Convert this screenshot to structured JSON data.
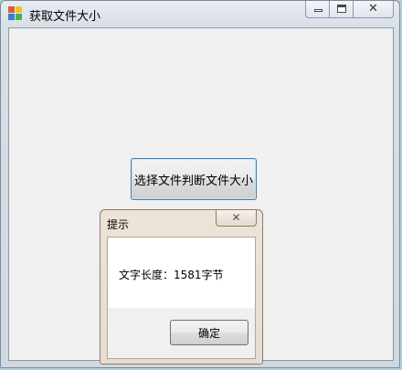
{
  "window": {
    "title": "获取文件大小",
    "icon": "app-icon",
    "caption_buttons": {
      "minimize_icon": "minimize-icon",
      "maximize_icon": "maximize-icon",
      "close_glyph": "✕"
    }
  },
  "main": {
    "select_button_label": "选择文件判断文件大小"
  },
  "dialog": {
    "title": "提示",
    "close_glyph": "✕",
    "message": "文字长度：1581字节",
    "ok_label": "确定"
  },
  "colors": {
    "client_background": "#f0f0f0",
    "button_focus_border": "#3c7fb1"
  }
}
